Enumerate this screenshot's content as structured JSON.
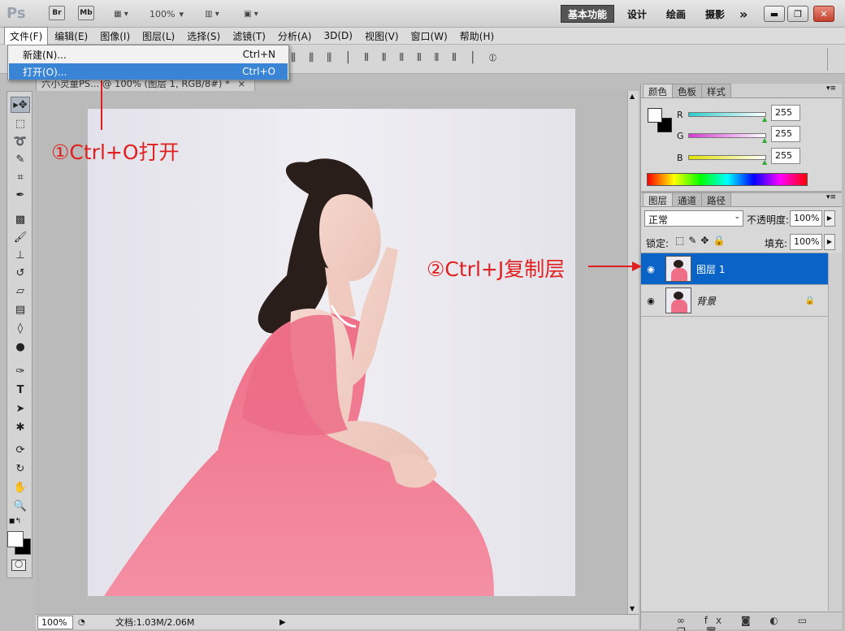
{
  "app": {
    "logo": "Ps",
    "br_label": "Br",
    "mb_label": "Mb",
    "zoom": "100%"
  },
  "workspaces": {
    "essentials": "基本功能",
    "design": "设计",
    "painting": "绘画",
    "photography": "摄影",
    "more": "»"
  },
  "window_buttons": {
    "minimize": "▬",
    "maximize": "❐",
    "close": "✕"
  },
  "menu": [
    "文件(F)",
    "编辑(E)",
    "图像(I)",
    "图层(L)",
    "选择(S)",
    "滤镜(T)",
    "分析(A)",
    "3D(D)",
    "视图(V)",
    "窗口(W)",
    "帮助(H)"
  ],
  "file_menu": {
    "items": [
      {
        "label": "新建(N)...",
        "shortcut": "Ctrl+N"
      },
      {
        "label": "打开(O)...",
        "shortcut": "Ctrl+O"
      }
    ]
  },
  "document": {
    "tab_title": "六小灵童PS... @ 100% (图层 1, RGB/8#) *",
    "close": "×"
  },
  "status": {
    "zoom": "100%",
    "doc_info": "文档:1.03M/2.06M"
  },
  "color_panel": {
    "tabs": [
      "颜色",
      "色板",
      "样式"
    ],
    "channels": [
      {
        "label": "R",
        "value": "255",
        "color": "#2ecccc"
      },
      {
        "label": "G",
        "value": "255",
        "color": "#d43ad4"
      },
      {
        "label": "B",
        "value": "255",
        "color": "#e0e000"
      }
    ]
  },
  "layers_panel": {
    "tabs": [
      "图层",
      "通道",
      "路径"
    ],
    "blend_mode": "正常",
    "opacity_label": "不透明度:",
    "opacity_value": "100%",
    "lock_label": "锁定:",
    "fill_label": "填充:",
    "fill_value": "100%",
    "layers": [
      {
        "name": "图层 1",
        "selected": true
      },
      {
        "name": "背景",
        "selected": false
      }
    ]
  },
  "annotations": {
    "step1": "①Ctrl+O打开",
    "step2": "②Ctrl+J复制层"
  },
  "colors": {
    "accent": "#0a64c8",
    "annotation": "#e02020",
    "dress": "#ef6f88"
  }
}
